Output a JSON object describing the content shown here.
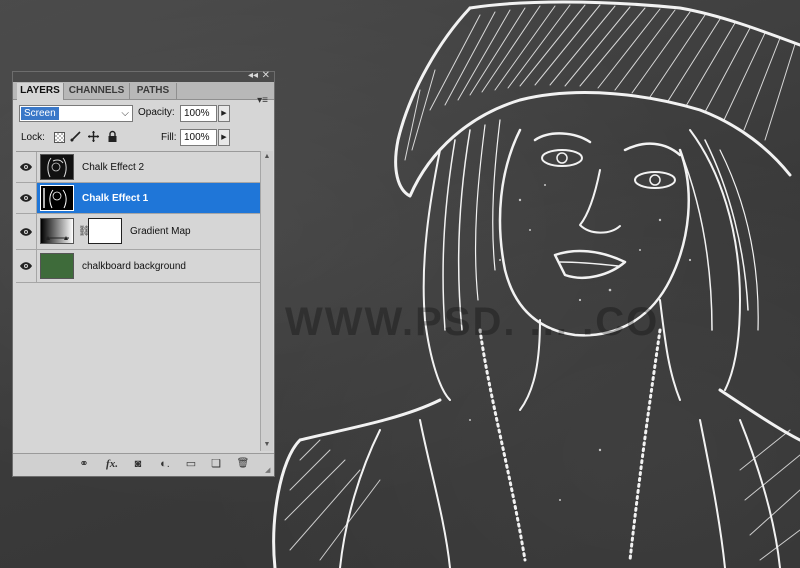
{
  "panel": {
    "tabs": [
      {
        "label": "LAYERS",
        "active": true
      },
      {
        "label": "CHANNELS",
        "active": false
      },
      {
        "label": "PATHS",
        "active": false
      }
    ],
    "collapse_glyph": "◂◂",
    "close_glyph": "✕",
    "menu_glyph": "▾≡"
  },
  "controls": {
    "blend_mode": "Screen",
    "blend_arrow": "⌵",
    "opacity_label": "Opacity:",
    "opacity_value": "100%",
    "lock_label": "Lock:",
    "fill_label": "Fill:",
    "fill_value": "100%",
    "spin_glyph": "▶"
  },
  "layers": [
    {
      "name": "Chalk Effect 2",
      "selected": false,
      "visible": true
    },
    {
      "name": "Chalk Effect 1",
      "selected": true,
      "visible": true
    },
    {
      "name": "Gradient Map",
      "selected": false,
      "visible": true
    },
    {
      "name": "chalkboard background",
      "selected": false,
      "visible": true
    }
  ],
  "bottom_toolbar": {
    "link": "⚭",
    "fx": "fx.",
    "mask": "◙",
    "adjustment": "◐.",
    "group": "▭",
    "new_layer": "❏",
    "delete": "🗑"
  },
  "watermark": "WWW.PSD. ... .CO",
  "colors": {
    "selection": "#1f76d8",
    "chalkboard": "#3f3f3f",
    "chalk": "#ffffff",
    "board_green": "#3e6b3a"
  }
}
